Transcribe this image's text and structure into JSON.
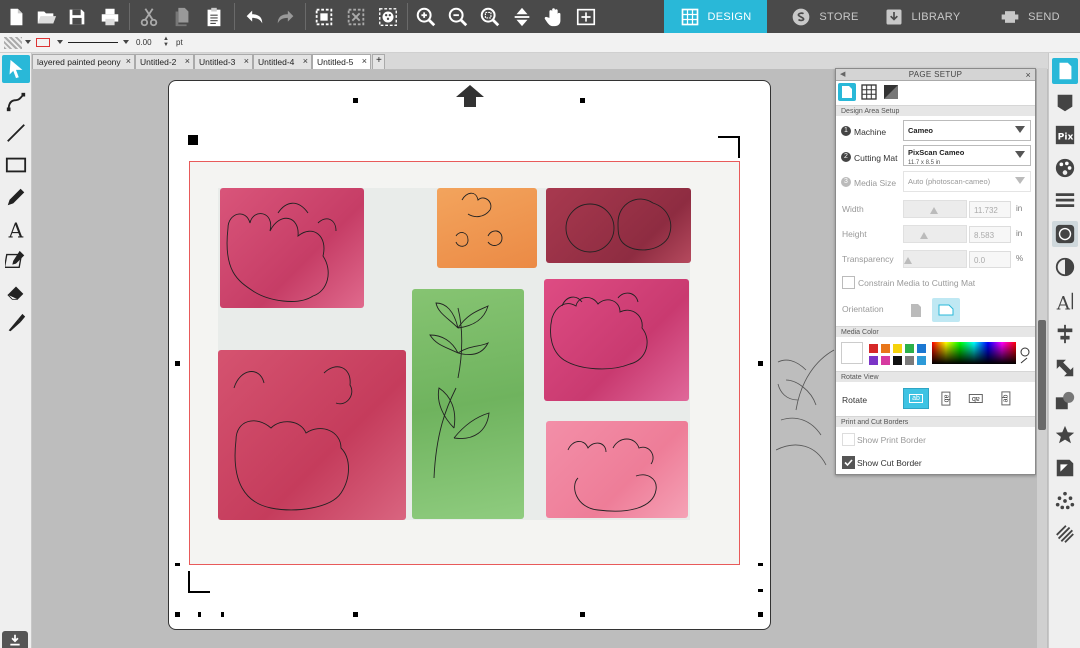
{
  "app": {
    "accent": "#29b8d8",
    "toolbar_bg": "#4a4a4a"
  },
  "nav_tabs": [
    {
      "label": "DESIGN",
      "icon": "grid-icon",
      "active": true
    },
    {
      "label": "STORE",
      "icon": "store-icon",
      "active": false
    },
    {
      "label": "LIBRARY",
      "icon": "library-icon",
      "active": false
    },
    {
      "label": "SEND",
      "icon": "send-icon",
      "active": false
    }
  ],
  "propbar": {
    "line_width": "0.00",
    "unit": "pt"
  },
  "doc_tabs": [
    {
      "label": "layered painted peony",
      "active": false
    },
    {
      "label": "Untitled-2",
      "active": false
    },
    {
      "label": "Untitled-3",
      "active": false
    },
    {
      "label": "Untitled-4",
      "active": false
    },
    {
      "label": "Untitled-5",
      "active": true
    }
  ],
  "doc_tab_add": "+",
  "doc_tab_close": "×",
  "panel": {
    "title": "PAGE SETUP",
    "close": "×",
    "collapse": "◀",
    "section_design": "Design Area Setup",
    "machine_num": "1",
    "machine_label": "Machine",
    "machine_value": "Cameo",
    "mat_num": "2",
    "mat_label": "Cutting Mat",
    "mat_value": "PixScan Cameo",
    "mat_sub": "11.7 x 8.5 in",
    "media_num": "3",
    "media_label": "Media Size",
    "media_value": "Auto (photoscan-cameo)",
    "width_label": "Width",
    "width_value": "11.732",
    "height_label": "Height",
    "height_value": "8.583",
    "unit_in": "in",
    "transparency_label": "Transparency",
    "transparency_value": "0.0",
    "unit_pct": "%",
    "constrain_label": "Constrain Media to Cutting Mat",
    "orientation_label": "Orientation",
    "section_color": "Media Color",
    "swatches": [
      "#d62828",
      "#e8761a",
      "#f5d20c",
      "#2bb04a",
      "#1b77d2",
      "#7b35c7",
      "#d63aa0",
      "#111111",
      "#7a7a7a",
      "#2d9ad8"
    ],
    "section_rotate": "Rotate View",
    "rotate_label": "Rotate",
    "rotate_icons": [
      "ab",
      "ab",
      "ab",
      "ab"
    ],
    "section_border": "Print and Cut Borders",
    "print_border_label": "Show Print Border",
    "cut_border_label": "Show Cut Border"
  }
}
